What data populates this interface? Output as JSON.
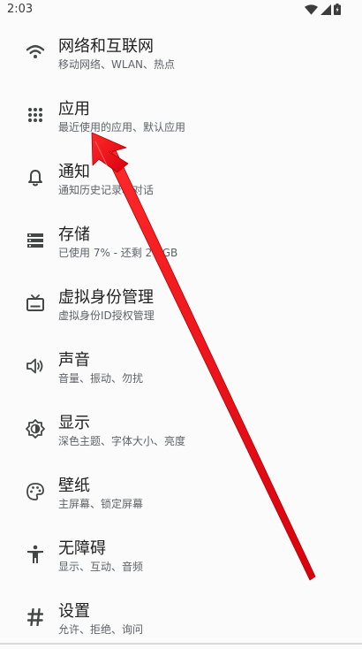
{
  "status_bar": {
    "time": "2:03",
    "icons": [
      "wifi-icon",
      "cell-signal-icon",
      "battery-icon"
    ]
  },
  "settings": {
    "items": [
      {
        "title": "网络和互联网",
        "summary": "移动网络、WLAN、热点",
        "icon": "wifi-icon"
      },
      {
        "title": "应用",
        "summary": "最近使用的应用、默认应用",
        "icon": "apps-grid-icon"
      },
      {
        "title": "通知",
        "summary": "通知历史记录、对话",
        "icon": "bell-icon"
      },
      {
        "title": "存储",
        "summary": "已使用 7% - 还剩 27 GB",
        "icon": "storage-icon"
      },
      {
        "title": "虚拟身份管理",
        "summary": "虚拟身份ID授权管理",
        "icon": "tv-icon"
      },
      {
        "title": "声音",
        "summary": "音量、振动、勿扰",
        "icon": "volume-icon"
      },
      {
        "title": "显示",
        "summary": "深色主题、字体大小、亮度",
        "icon": "brightness-icon"
      },
      {
        "title": "壁纸",
        "summary": "主屏幕、锁定屏幕",
        "icon": "palette-icon"
      },
      {
        "title": "无障碍",
        "summary": "显示、互动、音频",
        "icon": "accessibility-icon"
      },
      {
        "title": "设置",
        "summary": "允许、拒绝、询问",
        "icon": "hash-icon"
      }
    ]
  },
  "colors": {
    "icon": "#444746",
    "arrow": "#e8141b",
    "background": "#fbfbfb"
  }
}
